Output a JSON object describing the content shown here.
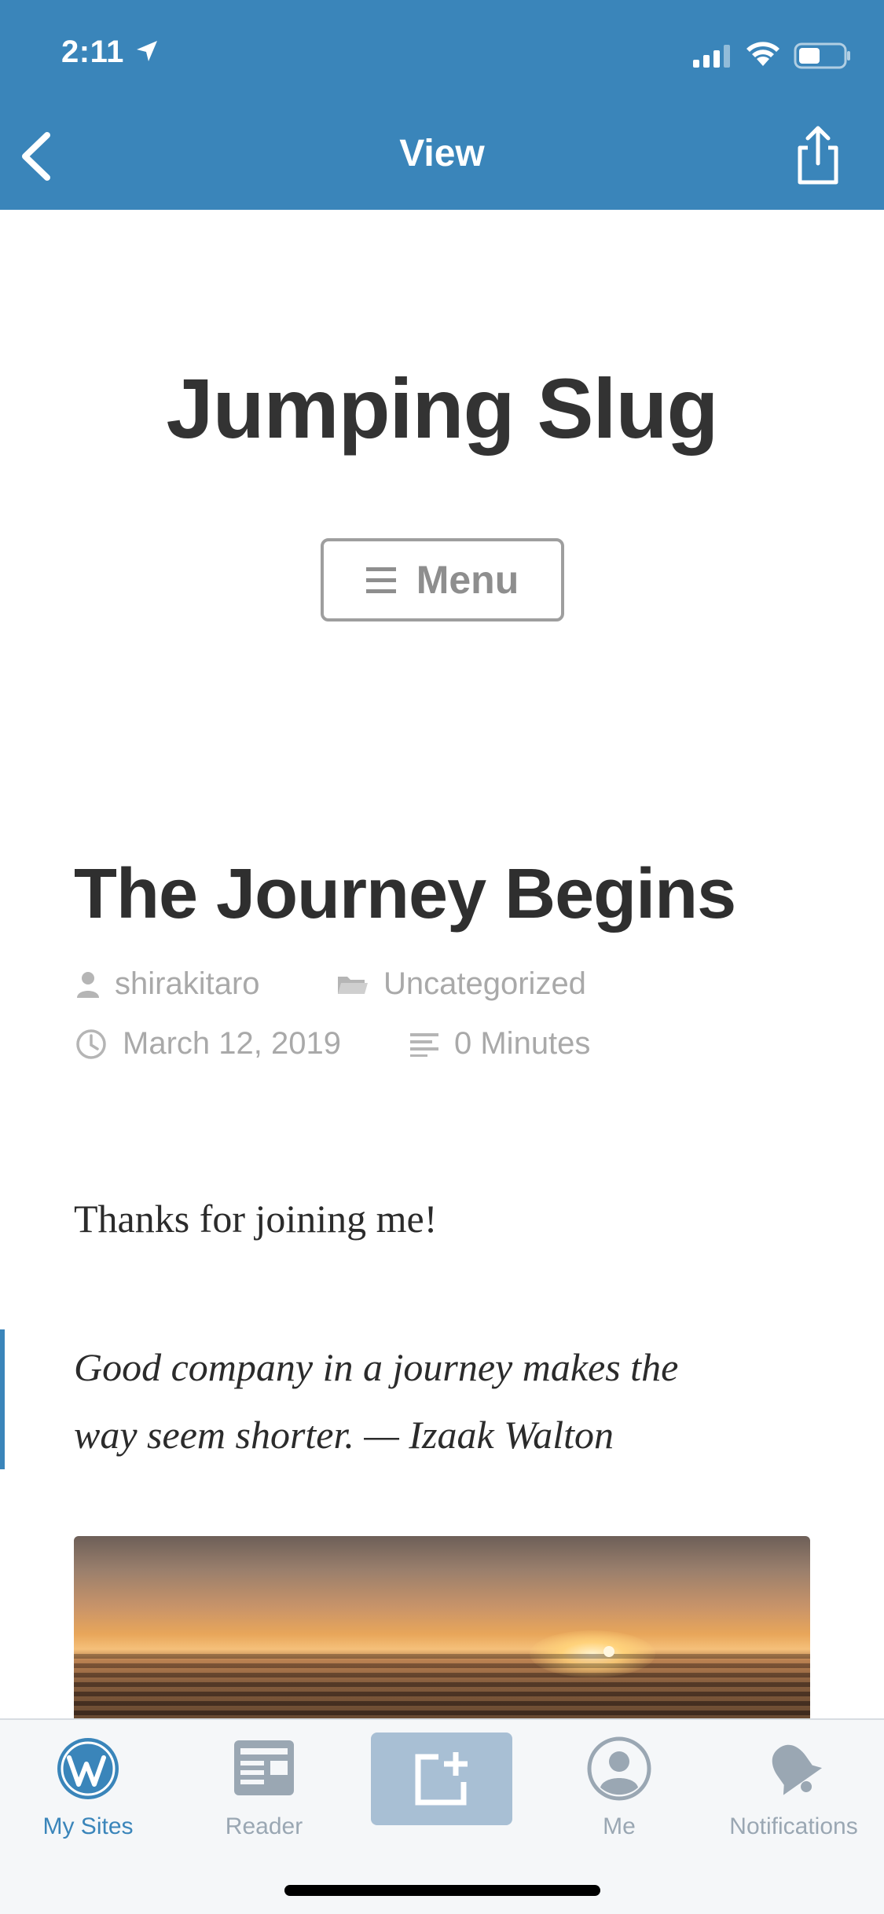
{
  "status_bar": {
    "time": "2:11"
  },
  "header": {
    "title": "View"
  },
  "site": {
    "title": "Jumping Slug",
    "menu_label": "Menu"
  },
  "post": {
    "title": "The Journey Begins",
    "author": "shirakitaro",
    "category": "Uncategorized",
    "date": "March 12, 2019",
    "reading_time": "0 Minutes",
    "intro": "Thanks for joining me!",
    "quote_line1": "Good company in a journey makes the",
    "quote_line2": "way seem shorter. — Izaak Walton"
  },
  "tab_bar": {
    "items": [
      {
        "label": "My Sites",
        "icon": "wordpress-icon",
        "active": true
      },
      {
        "label": "Reader",
        "icon": "reader-icon",
        "active": false
      },
      {
        "label": "",
        "icon": "write-icon",
        "active": false
      },
      {
        "label": "Me",
        "icon": "me-icon",
        "active": false
      },
      {
        "label": "Notifications",
        "icon": "bell-icon",
        "active": false
      }
    ]
  },
  "colors": {
    "brand": "#3a85ba",
    "tab_inactive": "#9aa7b3",
    "text": "#333333",
    "meta": "#a9a9a9"
  }
}
